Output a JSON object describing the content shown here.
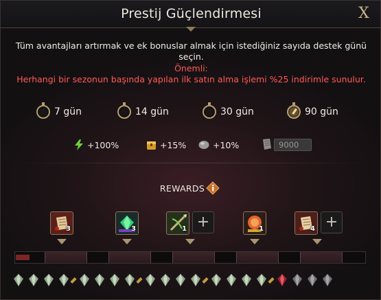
{
  "dialog": {
    "title": "Prestij Güçlendirmesi",
    "close_label": "X"
  },
  "description": "Tüm avantajları artırmak ve ek bonuslar almak için istediğiniz sayıda destek günü seçin.",
  "important": {
    "label": "Önemli:",
    "text": "Herhangi bir sezonun başında yapılan ilk satın alma işlemi %25 indirimle sunulur."
  },
  "duration_options": [
    {
      "label": "7 gün",
      "selected": false
    },
    {
      "label": "14 gün",
      "selected": false
    },
    {
      "label": "30 gün",
      "selected": false
    },
    {
      "label": "90 gün",
      "selected": true
    }
  ],
  "bonuses": [
    {
      "icon": "lightning-icon",
      "value": "+100%"
    },
    {
      "icon": "chest-icon",
      "value": "+15%"
    },
    {
      "icon": "stone-icon",
      "value": "+10%"
    }
  ],
  "points": {
    "icon": "scroll-icon",
    "value": "9000"
  },
  "rewards": {
    "title": "REWARDS",
    "items": [
      {
        "icon": "scroll-reward-icon",
        "count": "3"
      },
      {
        "icon": "green-gem-reward-icon",
        "count": "3"
      },
      {
        "icon": "crossbow-reward-icon",
        "count": "1"
      },
      {
        "icon": "rune-reward-icon",
        "count": "1"
      },
      {
        "icon": "scroll-reward-icon",
        "count": "4"
      }
    ],
    "progress_fraction": 0.04
  },
  "colors": {
    "important": "#ff5a5a",
    "accent_gold": "#b59e70",
    "progress_fill": "#7a2626"
  }
}
